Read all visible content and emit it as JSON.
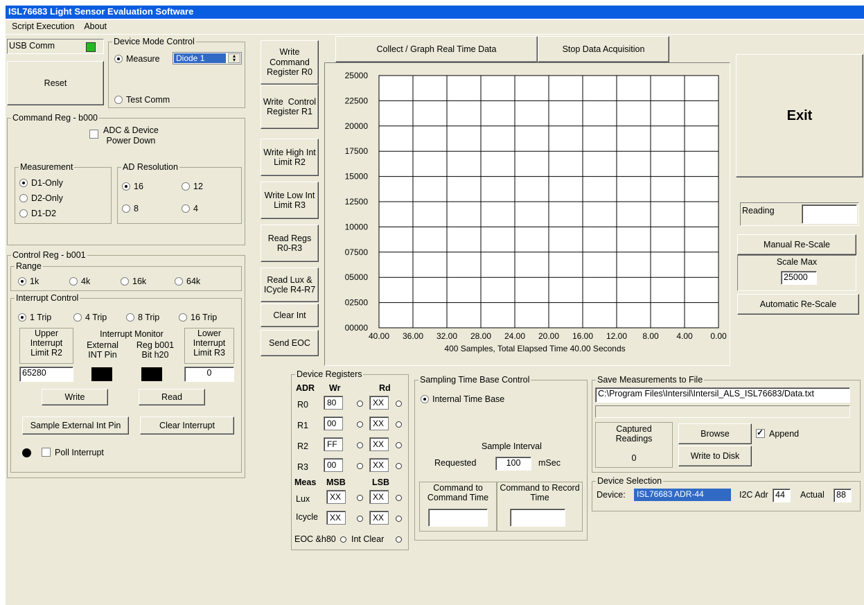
{
  "title": "ISL76683 Light Sensor Evaluation Software",
  "menu": [
    "Script Execution",
    "About"
  ],
  "usb": {
    "label": "USB Comm",
    "status_color": "#22bb22"
  },
  "reset_label": "Reset",
  "device_mode": {
    "legend": "Device Mode Control",
    "measure": "Measure",
    "diode": "Diode 1",
    "test": "Test Comm"
  },
  "command_reg": {
    "legend": "Command Reg - b000",
    "adc_power_down": "ADC & Device\nPower Down",
    "measurement": {
      "legend": "Measurement",
      "options": [
        "D1-Only",
        "D2-Only",
        "D1-D2"
      ]
    },
    "ad_resolution": {
      "legend": "AD Resolution",
      "options": [
        "16",
        "12",
        "8",
        "4"
      ]
    }
  },
  "control_reg": {
    "legend": "Control Reg - b001",
    "range": {
      "legend": "Range",
      "options": [
        "1k",
        "4k",
        "16k",
        "64k"
      ]
    },
    "interrupt": {
      "legend": "Interrupt Control",
      "trips": [
        "1 Trip",
        "4 Trip",
        "8 Trip",
        "16 Trip"
      ],
      "upper_label": "Upper\nInterrupt\nLimit R2",
      "monitor_label": "Interrupt Monitor",
      "ext_label": "External\nINT Pin",
      "reg_label": "Reg b001\nBit h20",
      "lower_label": "Lower\nInterrupt\nLimit R3",
      "upper_value": "65280",
      "lower_value": "0",
      "write": "Write",
      "read": "Read",
      "sample_ext": "Sample External Int Pin",
      "clear": "Clear Interrupt",
      "poll": "Poll Interrupt"
    }
  },
  "reg_buttons": [
    "Write\nCommand\nRegister R0",
    "Write  Control\nRegister R1",
    "Write High Int\nLimit R2",
    "Write Low Int\nLimit R3",
    "Read Regs\nR0-R3",
    "Read Lux &\nICycle R4-R7",
    "Clear Int",
    "Send EOC"
  ],
  "collect_label": "Collect / Graph Real Time Data",
  "stop_label": "Stop Data Acquisition",
  "exit_label": "Exit",
  "chart_data": {
    "type": "line",
    "y_ticks": [
      "25000",
      "22500",
      "20000",
      "17500",
      "15000",
      "12500",
      "10000",
      "07500",
      "05000",
      "02500",
      "00000"
    ],
    "x_ticks": [
      "40.00",
      "36.00",
      "32.00",
      "28.00",
      "24.00",
      "20.00",
      "16.00",
      "12.00",
      "8.00",
      "4.00",
      "0.00"
    ],
    "xlabel": "400 Samples, Total Elapsed Time 40.00 Seconds",
    "ylim": [
      0,
      25000
    ],
    "xlim": [
      40,
      0
    ],
    "grid": true,
    "series": []
  },
  "reading": {
    "label": "Reading",
    "value": ""
  },
  "manual_rescale": "Manual Re-Scale",
  "scale_max": {
    "label": "Scale Max",
    "value": "25000"
  },
  "auto_rescale": "Automatic Re-Scale",
  "device_registers": {
    "legend": "Device Registers",
    "adr": "ADR",
    "wr": "Wr",
    "rd": "Rd",
    "rows": [
      {
        "name": "R0",
        "wr": "80",
        "rd": "XX"
      },
      {
        "name": "R1",
        "wr": "00",
        "rd": "XX"
      },
      {
        "name": "R2",
        "wr": "FF",
        "rd": "XX"
      },
      {
        "name": "R3",
        "wr": "00",
        "rd": "XX"
      }
    ],
    "meas": "Meas",
    "msb": "MSB",
    "lsb": "LSB",
    "meas_rows": [
      {
        "name": "Lux",
        "msb": "XX",
        "lsb": "XX"
      },
      {
        "name": "Icycle",
        "msb": "XX",
        "lsb": "XX"
      }
    ],
    "eoc": "EOC &h80",
    "int_clear": "Int Clear"
  },
  "sampling": {
    "legend": "Sampling Time Base Control",
    "internal": "Internal Time Base",
    "interval": "Sample Interval",
    "requested": "Requested",
    "value": "100",
    "unit": "mSec",
    "cmd_to_cmd": "Command to\nCommand Time",
    "cmd_to_rec": "Command to Record\nTime"
  },
  "save": {
    "legend": "Save Measurements to File",
    "path": "C:\\Program Files\\Intersil\\Intersil_ALS_ISL76683/Data.txt",
    "captured": "Captured\nReadings",
    "count": "0",
    "browse": "Browse",
    "write_disk": "Write to Disk",
    "append": "Append"
  },
  "device_selection": {
    "legend": "Device Selection",
    "device_label": "Device:",
    "device_value": "ISL76683 ADR-44",
    "i2c_label": "I2C Adr",
    "i2c_value": "44",
    "actual_label": "Actual",
    "actual_value": "88"
  }
}
